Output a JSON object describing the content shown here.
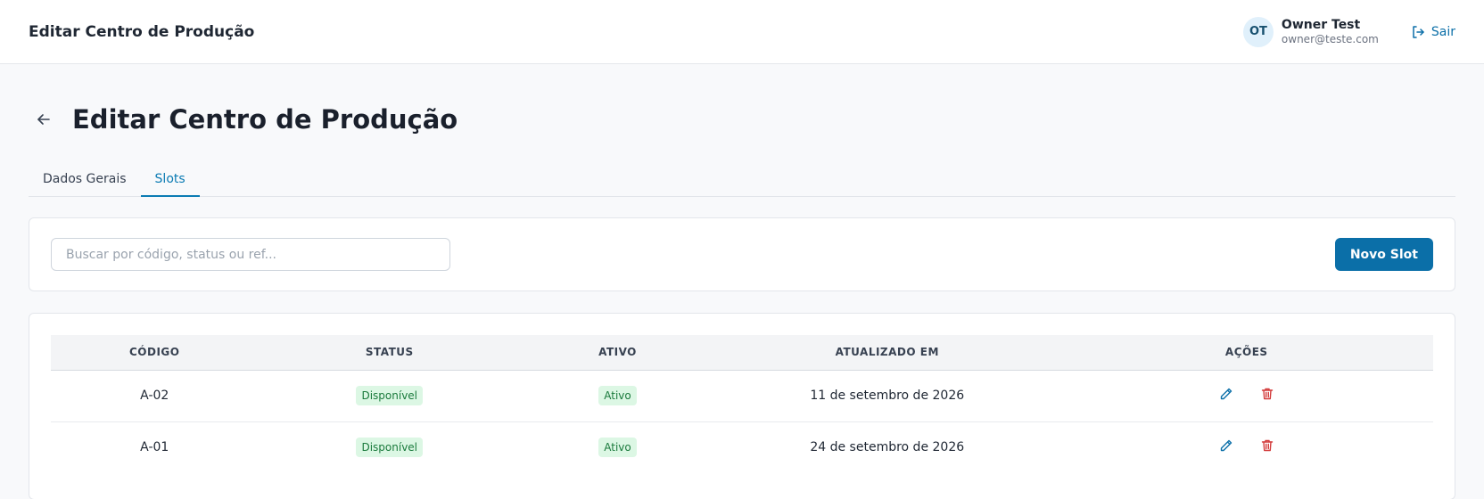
{
  "topbar": {
    "title": "Editar Centro de Produção",
    "user": {
      "initials": "OT",
      "name": "Owner Test",
      "email": "owner@teste.com"
    },
    "logout_label": "Sair"
  },
  "page": {
    "title": "Editar Centro de Produção",
    "back_icon": "arrow-left-icon"
  },
  "tabs": [
    {
      "label": "Dados Gerais",
      "active": false
    },
    {
      "label": "Slots",
      "active": true
    }
  ],
  "search": {
    "placeholder": "Buscar por código, status ou ref...",
    "value": ""
  },
  "new_slot_label": "Novo Slot",
  "table": {
    "columns": [
      "CÓDIGO",
      "STATUS",
      "ATIVO",
      "ATUALIZADO EM",
      "AÇÕES"
    ],
    "rows": [
      {
        "code": "A-02",
        "status": "Disponível",
        "active": "Ativo",
        "updated": "11 de setembro de 2026"
      },
      {
        "code": "A-01",
        "status": "Disponível",
        "active": "Ativo",
        "updated": "24 de setembro de 2026"
      }
    ]
  },
  "colors": {
    "primary": "#0b6fa8",
    "badge_bg": "#dcf7e4",
    "badge_text": "#1a7a3c",
    "delete": "#d33b3b"
  },
  "icons": {
    "edit": "pencil-icon",
    "delete": "trash-icon",
    "logout": "logout-icon"
  }
}
